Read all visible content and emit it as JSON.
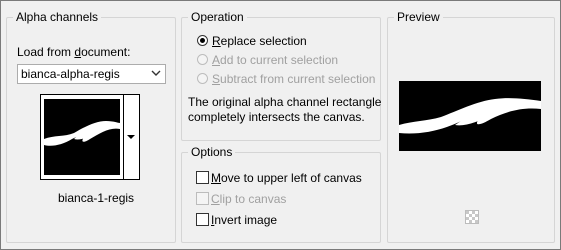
{
  "alpha_channels": {
    "title": "Alpha channels",
    "load_label_prefix": "Load from ",
    "load_label_link": "d",
    "load_label_suffix": "ocument:",
    "document_value": "bianca-alpha-regis",
    "channel_name": "bianca-1-regis"
  },
  "operation": {
    "title": "Operation",
    "options": [
      {
        "prefix": "",
        "mnemonic": "R",
        "rest": "eplace selection",
        "selected": true,
        "enabled": true
      },
      {
        "prefix": "",
        "mnemonic": "A",
        "rest": "dd to current selection",
        "selected": false,
        "enabled": false
      },
      {
        "prefix": "",
        "mnemonic": "S",
        "rest": "ubtract from current selection",
        "selected": false,
        "enabled": false
      }
    ],
    "note_line1": "The original alpha channel rectangle",
    "note_line2": "completely intersects the canvas."
  },
  "options": {
    "title": "Options",
    "items": [
      {
        "prefix": "",
        "mnemonic": "M",
        "rest": "ove to upper left of canvas",
        "checked": false,
        "enabled": true
      },
      {
        "prefix": "",
        "mnemonic": "C",
        "rest": "lip to canvas",
        "checked": false,
        "enabled": false
      },
      {
        "prefix": "",
        "mnemonic": "I",
        "rest": "nvert image",
        "checked": false,
        "enabled": true
      }
    ]
  },
  "preview": {
    "title": "Preview"
  },
  "colors": {
    "dialog_bg": "#f0f0f0",
    "group_border": "#d5d5d5",
    "disabled_text": "#a0a0a0"
  }
}
